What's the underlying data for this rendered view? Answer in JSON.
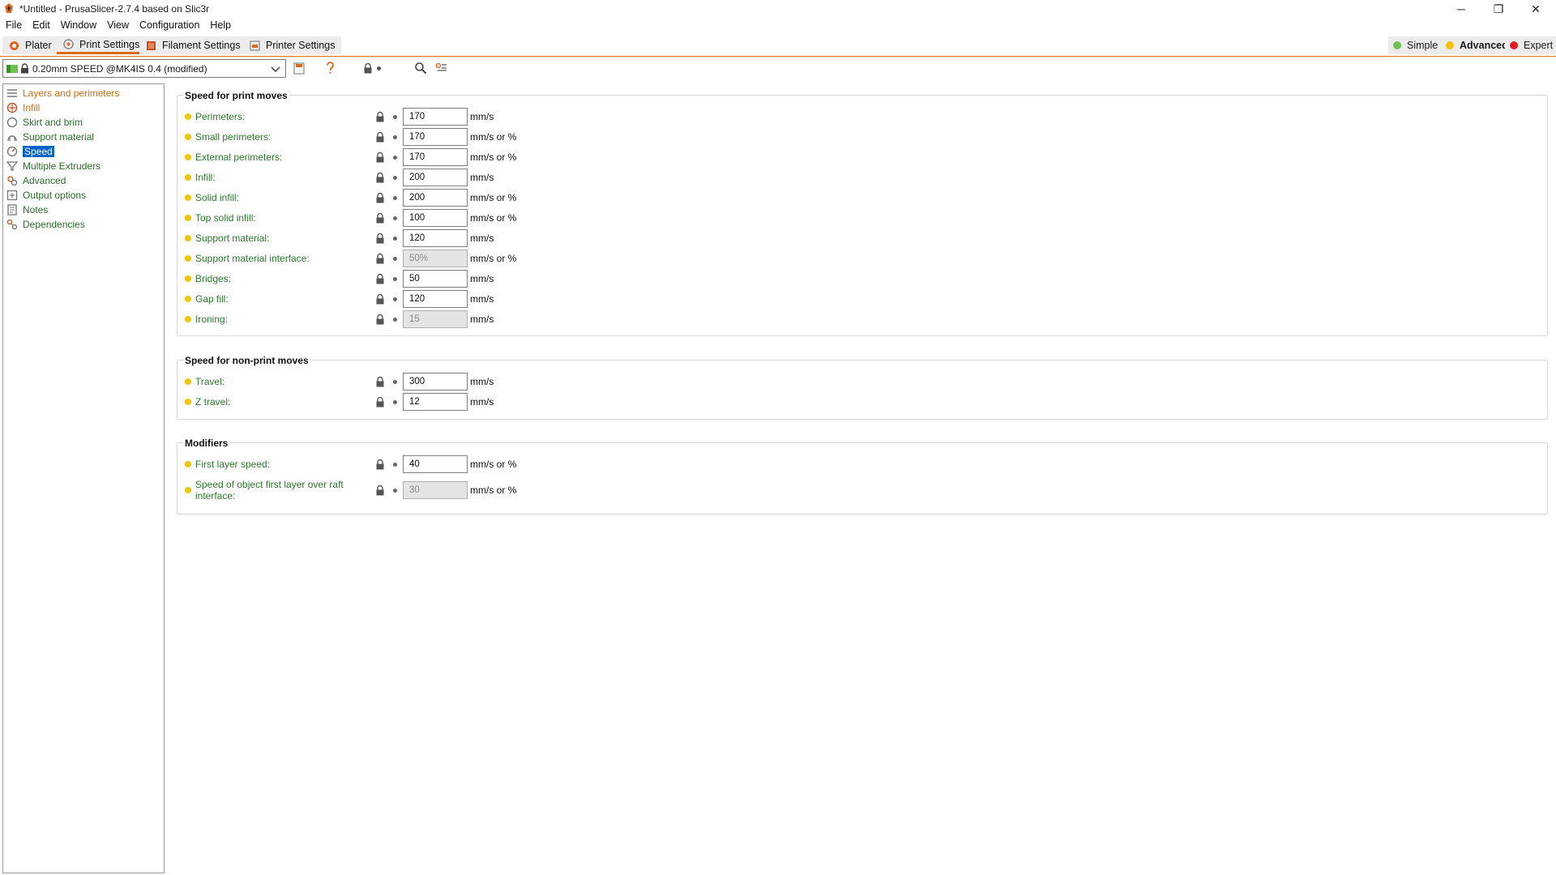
{
  "window": {
    "title": "*Untitled - PrusaSlicer-2.7.4 based on Slic3r",
    "minimize": "─",
    "maximize": "❐",
    "close": "✕"
  },
  "menu": [
    "File",
    "Edit",
    "Window",
    "View",
    "Configuration",
    "Help"
  ],
  "tabs": [
    {
      "label": "Plater",
      "icon": "plater-icon"
    },
    {
      "label": "Print Settings",
      "icon": "print-settings-icon",
      "active": true
    },
    {
      "label": "Filament Settings",
      "icon": "filament-icon"
    },
    {
      "label": "Printer Settings",
      "icon": "printer-icon"
    }
  ],
  "modes": [
    {
      "label": "Simple",
      "color": "#6cc24a"
    },
    {
      "label": "Advanced",
      "color": "#f5c400",
      "active": true
    },
    {
      "label": "Expert",
      "color": "#e02020"
    }
  ],
  "preset": {
    "value": "0.20mm SPEED @MK4IS 0.4 (modified)"
  },
  "sidebar": [
    {
      "label": "Layers and perimeters",
      "icon": "layers-icon",
      "state": "orange"
    },
    {
      "label": "Infill",
      "icon": "infill-icon",
      "state": "orange"
    },
    {
      "label": "Skirt and brim",
      "icon": "skirt-icon",
      "state": ""
    },
    {
      "label": "Support material",
      "icon": "support-icon",
      "state": ""
    },
    {
      "label": "Speed",
      "icon": "speed-icon",
      "state": "selected"
    },
    {
      "label": "Multiple Extruders",
      "icon": "extruders-icon",
      "state": ""
    },
    {
      "label": "Advanced",
      "icon": "advanced-icon",
      "state": ""
    },
    {
      "label": "Output options",
      "icon": "output-icon",
      "state": ""
    },
    {
      "label": "Notes",
      "icon": "notes-icon",
      "state": ""
    },
    {
      "label": "Dependencies",
      "icon": "dependencies-icon",
      "state": ""
    }
  ],
  "groups": [
    {
      "title": "Speed for print moves",
      "rows": [
        {
          "label": "Perimeters:",
          "value": "170",
          "unit": "mm/s",
          "disabled": false
        },
        {
          "label": "Small perimeters:",
          "value": "170",
          "unit": "mm/s or %",
          "disabled": false
        },
        {
          "label": "External perimeters:",
          "value": "170",
          "unit": "mm/s or %",
          "disabled": false
        },
        {
          "label": "Infill:",
          "value": "200",
          "unit": "mm/s",
          "disabled": false
        },
        {
          "label": "Solid infill:",
          "value": "200",
          "unit": "mm/s or %",
          "disabled": false
        },
        {
          "label": "Top solid infill:",
          "value": "100",
          "unit": "mm/s or %",
          "disabled": false
        },
        {
          "label": "Support material:",
          "value": "120",
          "unit": "mm/s",
          "disabled": false
        },
        {
          "label": "Support material interface:",
          "value": "50%",
          "unit": "mm/s or %",
          "disabled": true
        },
        {
          "label": "Bridges:",
          "value": "50",
          "unit": "mm/s",
          "disabled": false
        },
        {
          "label": "Gap fill:",
          "value": "120",
          "unit": "mm/s",
          "disabled": false
        },
        {
          "label": "Ironing:",
          "value": "15",
          "unit": "mm/s",
          "disabled": true
        }
      ]
    },
    {
      "title": "Speed for non-print moves",
      "rows": [
        {
          "label": "Travel:",
          "value": "300",
          "unit": "mm/s",
          "disabled": false
        },
        {
          "label": "Z travel:",
          "value": "12",
          "unit": "mm/s",
          "disabled": false
        }
      ]
    },
    {
      "title": "Modifiers",
      "rows": [
        {
          "label": "First layer speed:",
          "value": "40",
          "unit": "mm/s or %",
          "disabled": false
        },
        {
          "label": "Speed of object first layer over raft interface:",
          "value": "30",
          "unit": "mm/s or %",
          "disabled": true
        }
      ]
    }
  ]
}
